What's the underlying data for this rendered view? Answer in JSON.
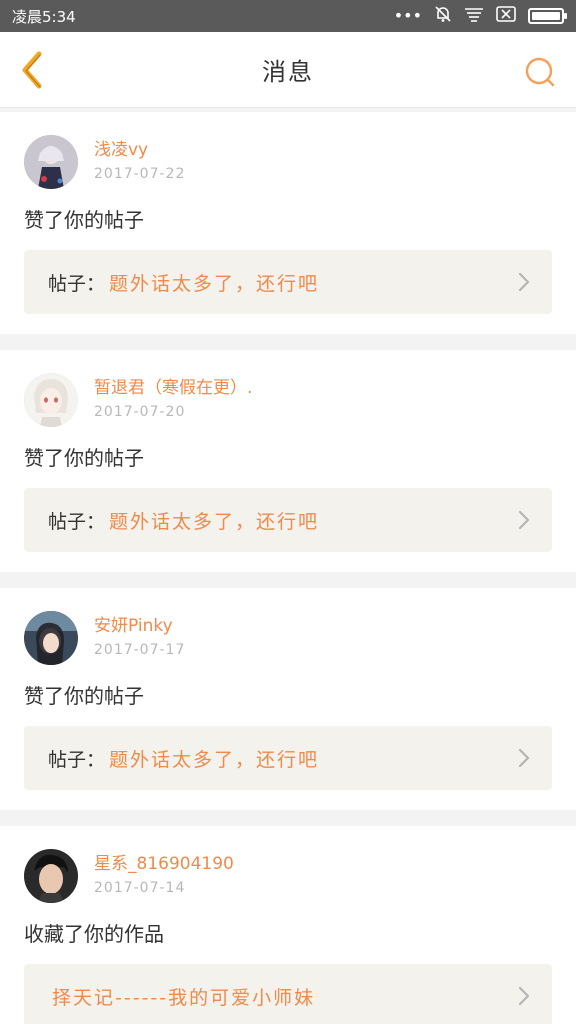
{
  "status_bar": {
    "time": "凌晨5:34",
    "icons": [
      "more-dots-icon",
      "bell-muted-icon",
      "signal-lines-icon",
      "no-sim-icon",
      "battery-icon"
    ],
    "battery_level": 1.0
  },
  "header": {
    "title": "消息",
    "back_icon": "chevron-left-icon",
    "search_icon": "search-icon",
    "accent_color": "#f5a623"
  },
  "notifications": [
    {
      "username": "浅凌vy",
      "date": "2017-07-22",
      "action": "赞了你的帖子",
      "post_label": "帖子：",
      "post_title": "题外话太多了，还行吧"
    },
    {
      "username": "暂退君（寒假在更）.",
      "date": "2017-07-20",
      "action": "赞了你的帖子",
      "post_label": "帖子：",
      "post_title": "题外话太多了，还行吧"
    },
    {
      "username": "安妍Pinky",
      "date": "2017-07-17",
      "action": "赞了你的帖子",
      "post_label": "帖子：",
      "post_title": "题外话太多了，还行吧"
    },
    {
      "username": "星系_816904190",
      "date": "2017-07-14",
      "action": "收藏了你的作品",
      "post_label": "",
      "post_title": "择天记------我的可爱小师妹"
    }
  ],
  "colors": {
    "username": "#f08a4b",
    "date": "#b8b8b8",
    "post_box_bg": "#f3f2ec"
  }
}
